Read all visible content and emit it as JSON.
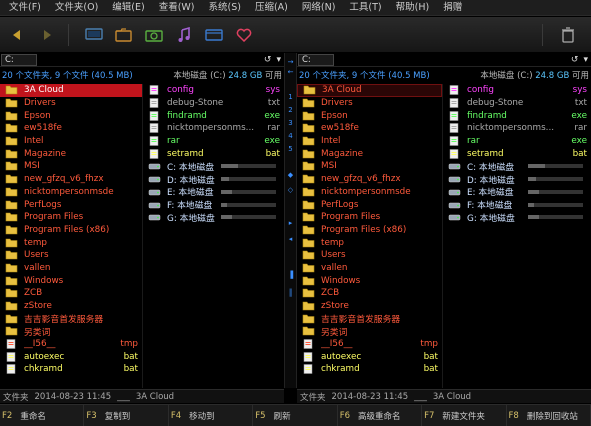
{
  "menubar": {
    "items": [
      "文件(F)",
      "文件夹(O)",
      "编辑(E)",
      "查看(W)",
      "系统(S)",
      "压缩(A)",
      "网络(N)",
      "工具(T)",
      "帮助(H)",
      "捐赠"
    ]
  },
  "toolbar": {
    "icons": [
      "back-arrow-icon",
      "forward-arrow-icon",
      "monitor-icon",
      "folders-icon",
      "camera-icon",
      "music-icon",
      "window-icon",
      "heart-icon",
      "trash-icon"
    ],
    "accent": "#f0c040"
  },
  "left": {
    "drive": "C:",
    "summary_count": "20 个文件夹, 9 个文件 (40.5 MB)",
    "summary_disk": "本地磁盘 (C:)",
    "summary_free": "24.8 GB",
    "summary_unit": "可用",
    "status": {
      "type": "文件夹",
      "date": "2014-08-23 11:45",
      "sep": "___",
      "name": "3A Cloud"
    }
  },
  "right": {
    "drive": "C:",
    "summary_count": "20 个文件夹, 9 个文件 (40.5 MB)",
    "summary_disk": "本地磁盘 (C:)",
    "summary_free": "24.8 GB",
    "summary_unit": "可用",
    "status": {
      "type": "文件夹",
      "date": "2014-08-23 11:45",
      "sep": "___",
      "name": "3A Cloud"
    }
  },
  "folders": [
    "3A Cloud",
    "Drivers",
    "Epson",
    "ew518fe",
    "Intel",
    "Magazine",
    "MSI",
    "new_gfzq_v6_fhzx",
    "nicktompersonmsde",
    "PerfLogs",
    "Program Files",
    "Program Files (x86)",
    "temp",
    "Users",
    "vallen",
    "Windows",
    "ZCB",
    "zStore",
    "吉吉影音首发服务器",
    "另类词"
  ],
  "left_extra_files": [
    {
      "name": "__I56__",
      "ext": "tmp",
      "color": "#ff5a3c"
    },
    {
      "name": "autoexec",
      "ext": "bat",
      "color": "#ffff66"
    },
    {
      "name": "chkramd",
      "ext": "bat",
      "color": "#ffff66"
    }
  ],
  "files": [
    {
      "name": "config",
      "ext": "sys",
      "color": "#ff44ff"
    },
    {
      "name": "debug-Stone",
      "ext": "txt",
      "color": "#aaaaaa"
    },
    {
      "name": "findramd",
      "ext": "exe",
      "color": "#66ff66"
    },
    {
      "name": "nicktompersonms...",
      "ext": "rar",
      "color": "#aaaaaa"
    },
    {
      "name": "rar",
      "ext": "exe",
      "color": "#66ff66"
    },
    {
      "name": "setramd",
      "ext": "bat",
      "color": "#ffff66"
    }
  ],
  "drives": [
    {
      "name": "C: 本地磁盘",
      "used": 0.3
    },
    {
      "name": "D: 本地磁盘",
      "used": 0.15
    },
    {
      "name": "E: 本地磁盘",
      "used": 0.2
    },
    {
      "name": "F: 本地磁盘",
      "used": 0.1
    },
    {
      "name": "G: 本地磁盘",
      "used": 0.2
    }
  ],
  "center_strip": [
    "1",
    "2",
    "3",
    "4",
    "5"
  ],
  "fkeys": [
    {
      "key": "F2",
      "label": "重命名"
    },
    {
      "key": "F3",
      "label": "复制到"
    },
    {
      "key": "F4",
      "label": "移动到"
    },
    {
      "key": "F5",
      "label": "刷新"
    },
    {
      "key": "F6",
      "label": "高级重命名"
    },
    {
      "key": "F7",
      "label": "新建文件夹"
    },
    {
      "key": "F8",
      "label": "删除到回收站"
    }
  ]
}
